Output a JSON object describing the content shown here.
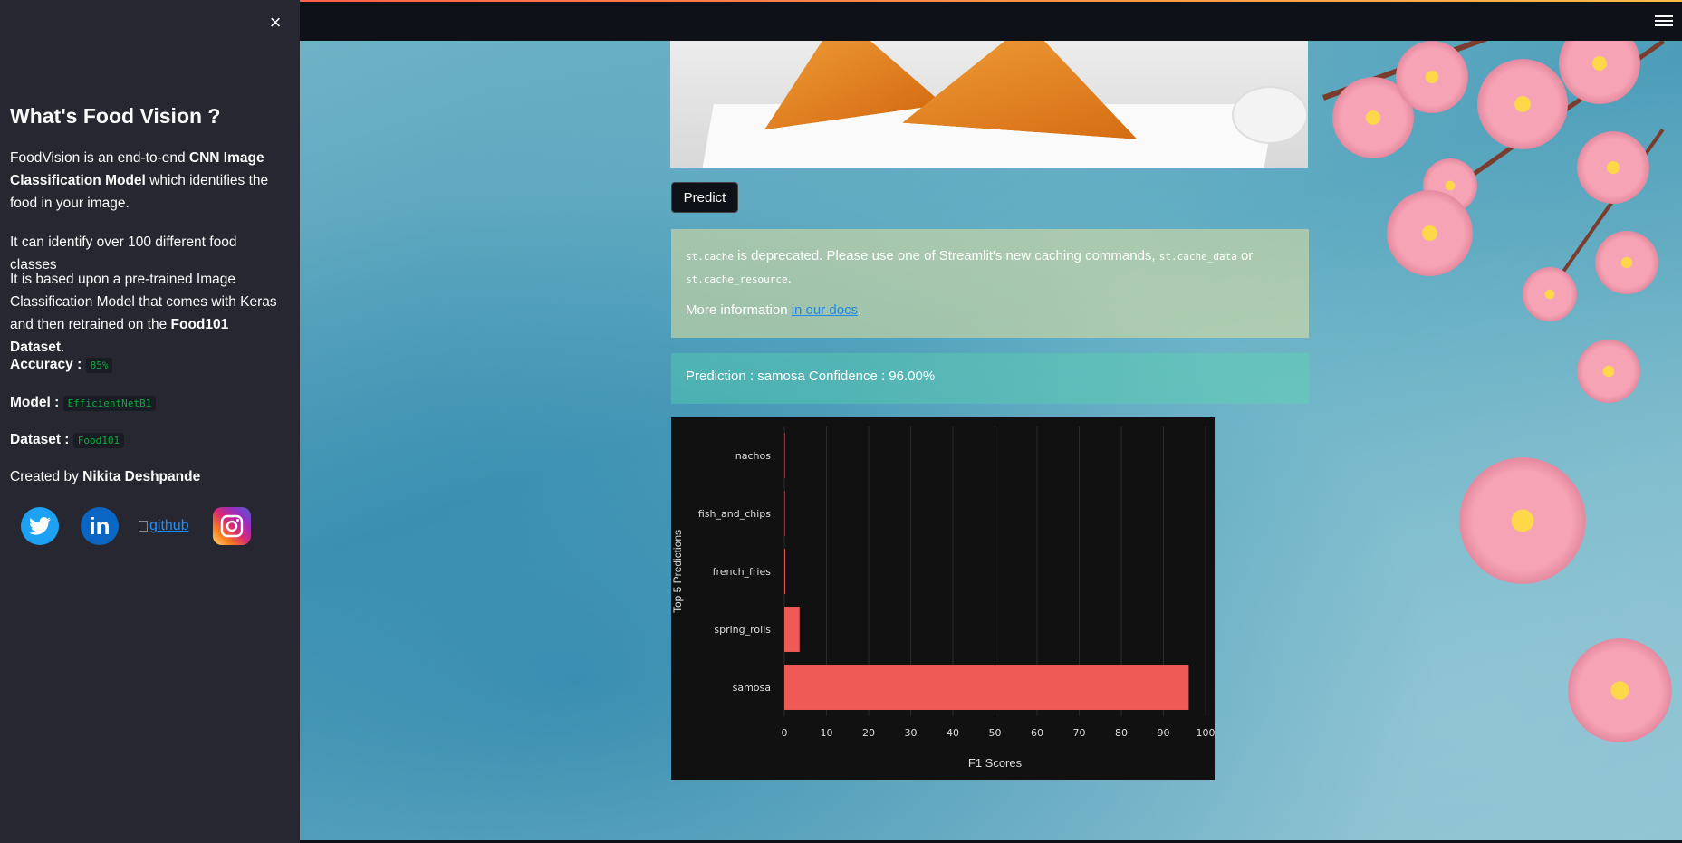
{
  "sidebar": {
    "close_label": "×",
    "title": "What's Food Vision ?",
    "p1_a": "FoodVision is an end-to-end ",
    "p1_b": "CNN Image Classification Model",
    "p1_c": " which identifies the food in your image.",
    "p2": "It can identify over 100 different food classes",
    "p3_a": "It is based upon a pre-trained Image Classification Model that comes with Keras and then retrained on the ",
    "p3_b": "Food101 Dataset",
    "p3_c": ".",
    "accuracy_label": "Accuracy :",
    "accuracy_value": "85%",
    "model_label": "Model :",
    "model_value": "EfficientNetB1",
    "dataset_label": "Dataset :",
    "dataset_value": "Food101",
    "created_prefix": "Created by ",
    "created_name": "Nikita Deshpande",
    "social": {
      "twitter_icon": "twitter-icon",
      "linkedin_icon": "linkedin-icon",
      "github_alt": "github",
      "instagram_icon": "instagram-icon"
    }
  },
  "main": {
    "predict_label": "Predict",
    "warning": {
      "code1": "st.cache",
      "text1": " is deprecated. Please use one of Streamlit's new caching commands, ",
      "code2": "st.cache_data",
      "text2": " or ",
      "code3": "st.cache_resource",
      "text3": ".",
      "more_prefix": "More information ",
      "more_link": "in our docs",
      "more_suffix": "."
    },
    "prediction_text": "Prediction : samosa Confidence : 96.00%"
  },
  "colors": {
    "sidebar_bg": "#262730",
    "app_bg": "#0e1117",
    "bar_color": "#ef5b54",
    "code_green": "#09ab3b",
    "link_blue": "#1e88e5"
  },
  "chart_data": {
    "type": "bar",
    "orientation": "horizontal",
    "categories": [
      "samosa",
      "spring_rolls",
      "french_fries",
      "fish_and_chips",
      "nachos"
    ],
    "values": [
      96.0,
      3.6,
      0.2,
      0.1,
      0.1
    ],
    "xlabel": "F1 Scores",
    "ylabel": "Top 5 Predictions",
    "xlim": [
      0,
      100
    ],
    "xticks": [
      "0",
      "10",
      "20",
      "30",
      "40",
      "50",
      "60",
      "70",
      "80",
      "90",
      "100"
    ],
    "grid": "vertical",
    "bar_color": "#ef5b54"
  }
}
